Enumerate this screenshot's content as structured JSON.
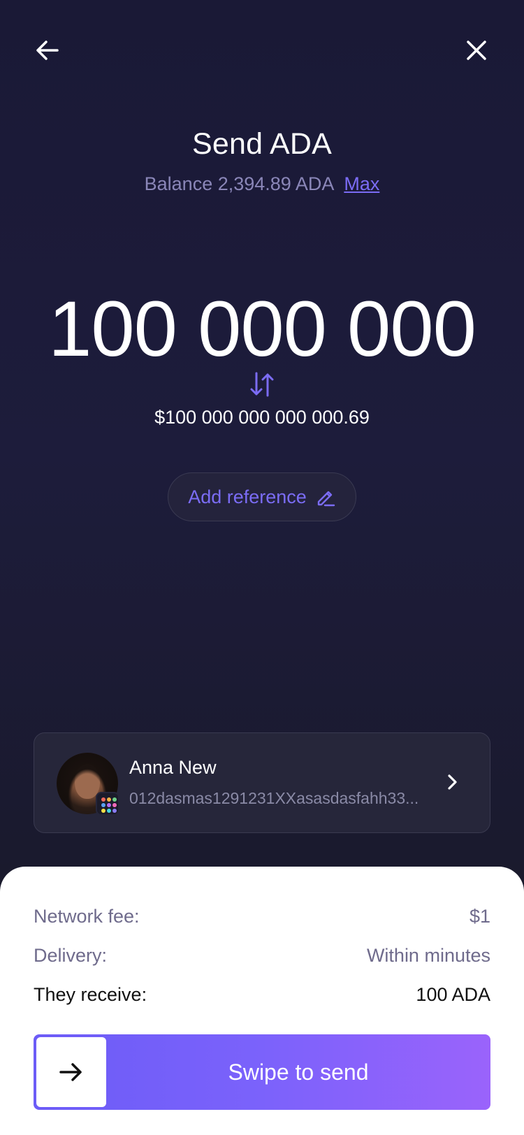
{
  "header": {
    "back_icon": "arrow-left-icon",
    "close_icon": "close-icon"
  },
  "send": {
    "title": "Send ADA",
    "balance_label": "Balance 2,394.89 ADA",
    "max_label": "Max",
    "amount": "100 000 000",
    "swap_icon": "swap-arrows-icon",
    "fiat_amount": "$100 000 000 000 000.69",
    "add_reference_label": "Add reference",
    "add_reference_icon": "pencil-icon"
  },
  "recipient": {
    "name": "Anna New",
    "address": "012dasmas1291231XXasasdasfahh33...",
    "chevron_icon": "chevron-right-icon"
  },
  "summary": {
    "network_fee_label": "Network fee:",
    "network_fee_value": "$1",
    "delivery_label": "Delivery:",
    "delivery_value": "Within minutes",
    "receive_label": "They receive:",
    "receive_value": "100 ADA"
  },
  "swipe": {
    "label": "Swipe to send",
    "handle_icon": "arrow-right-icon"
  },
  "colors": {
    "accent": "#7b6cf5",
    "muted": "#8a86b8",
    "background": "#1d1c3b"
  }
}
